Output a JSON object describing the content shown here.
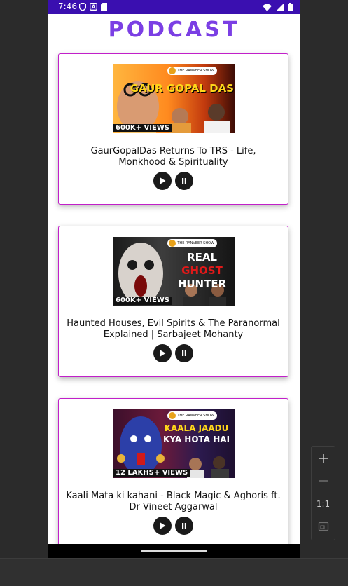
{
  "status_bar": {
    "time": "7:46"
  },
  "app": {
    "title": "PODCAST"
  },
  "episodes": [
    {
      "thumb_headline": "GAUR GOPAL DAS",
      "thumb_views": "600K+ VIEWS",
      "thumb_banner": "THE RANVEER SHOW",
      "title": "GaurGopalDas Returns To TRS - Life, Monkhood & Spirituality"
    },
    {
      "thumb_headline_1": "REAL",
      "thumb_headline_2": "GHOST",
      "thumb_headline_3": "HUNTER",
      "thumb_views": "600K+ VIEWS",
      "thumb_banner": "THE RANVEER SHOW",
      "title": "Haunted Houses, Evil Spirits & The Paranormal Explained | Sarbajeet Mohanty"
    },
    {
      "thumb_headline_1": "KAALA JAADU",
      "thumb_headline_2": "KYA HOTA HAI",
      "thumb_views": "12 LAKHS+ VIEWS",
      "thumb_banner": "THE RANVEER SHOW",
      "title": "Kaali Mata ki kahani - Black Magic & Aghoris ft. Dr Vineet Aggarwal"
    }
  ],
  "zoom_controls": {
    "reset_label": "1:1"
  },
  "colors": {
    "status_bar": "#3a0fb0",
    "title": "#7b3fe4",
    "card_border": "#c11fc9"
  }
}
